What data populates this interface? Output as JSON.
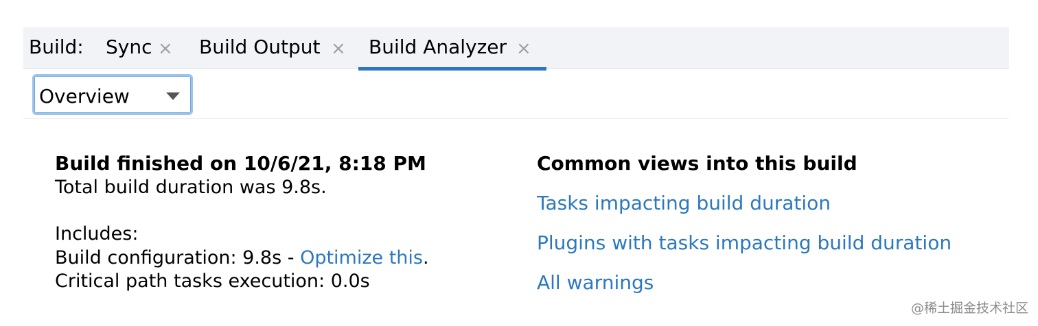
{
  "tabbar": {
    "prefix": "Build:",
    "tabs": [
      {
        "label": "Sync",
        "active": false
      },
      {
        "label": "Build Output",
        "active": false
      },
      {
        "label": "Build Analyzer",
        "active": true
      }
    ],
    "close_glyph": "×",
    "accent_color": "#2f74c5"
  },
  "view_selector": {
    "value": "Overview"
  },
  "summary": {
    "headline": "Build finished on 10/6/21, 8:18 PM",
    "duration": "Total build duration was 9.8s.",
    "includes_label": "Includes:",
    "config_prefix": "Build configuration: 9.8s - ",
    "config_link": "Optimize this",
    "config_suffix": ".",
    "critical_path": "Critical path tasks execution: 0.0s"
  },
  "common_views": {
    "title": "Common views into this build",
    "links": [
      "Tasks impacting build duration",
      "Plugins with tasks impacting build duration",
      "All warnings"
    ],
    "link_color": "#2b78bd"
  },
  "watermark": "@稀土掘金技术社区"
}
